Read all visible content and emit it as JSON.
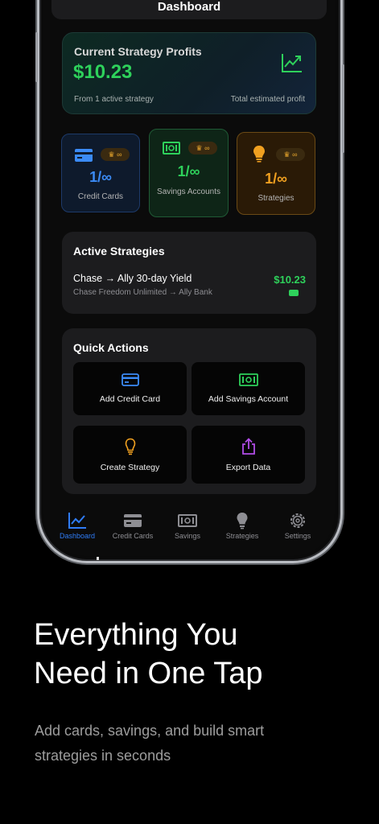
{
  "header": {
    "title": "Dashboard"
  },
  "profits": {
    "title": "Current Strategy Profits",
    "amount": "$10.23",
    "sub_left": "From 1 active strategy",
    "sub_right": "Total estimated profit",
    "accent": "#2ed15b"
  },
  "tiles": [
    {
      "count": "1/∞",
      "label": "Credit Cards",
      "color": "#3b8bf6",
      "icon": "credit-card-icon",
      "badge": "♛ ∞"
    },
    {
      "count": "1/∞",
      "label": "Savings Accounts",
      "color": "#2ed15b",
      "icon": "banknote-icon",
      "badge": "♛ ∞"
    },
    {
      "count": "1/∞",
      "label": "Strategies",
      "color": "#f0a020",
      "icon": "lightbulb-icon",
      "badge": "♛ ∞"
    }
  ],
  "active_strategies": {
    "title": "Active Strategies",
    "items": [
      {
        "name": "Chase → Ally 30-day Yield",
        "path": "Chase Freedom Unlimited  →  Ally Bank",
        "amount": "$10.23"
      }
    ]
  },
  "quick_actions": {
    "title": "Quick Actions",
    "buttons": [
      {
        "label": "Add Credit Card",
        "icon": "credit-card-icon",
        "color": "#3b8bf6"
      },
      {
        "label": "Add Savings Account",
        "icon": "banknote-icon",
        "color": "#2ed15b"
      },
      {
        "label": "Create Strategy",
        "icon": "lightbulb-icon",
        "color": "#f0a020"
      },
      {
        "label": "Export Data",
        "icon": "share-icon",
        "color": "#b24de8"
      }
    ]
  },
  "tabbar": {
    "items": [
      {
        "label": "Dashboard",
        "icon": "chart-icon",
        "active": true
      },
      {
        "label": "Credit Cards",
        "icon": "credit-card-icon",
        "active": false
      },
      {
        "label": "Savings",
        "icon": "banknote-icon",
        "active": false
      },
      {
        "label": "Strategies",
        "icon": "lightbulb-icon",
        "active": false
      },
      {
        "label": "Settings",
        "icon": "gear-icon",
        "active": false
      }
    ]
  },
  "marketing": {
    "headline_line1": "Everything You",
    "headline_line2": "Need in One Tap",
    "subline_line1": "Add cards, savings, and build smart",
    "subline_line2": "strategies in seconds"
  }
}
